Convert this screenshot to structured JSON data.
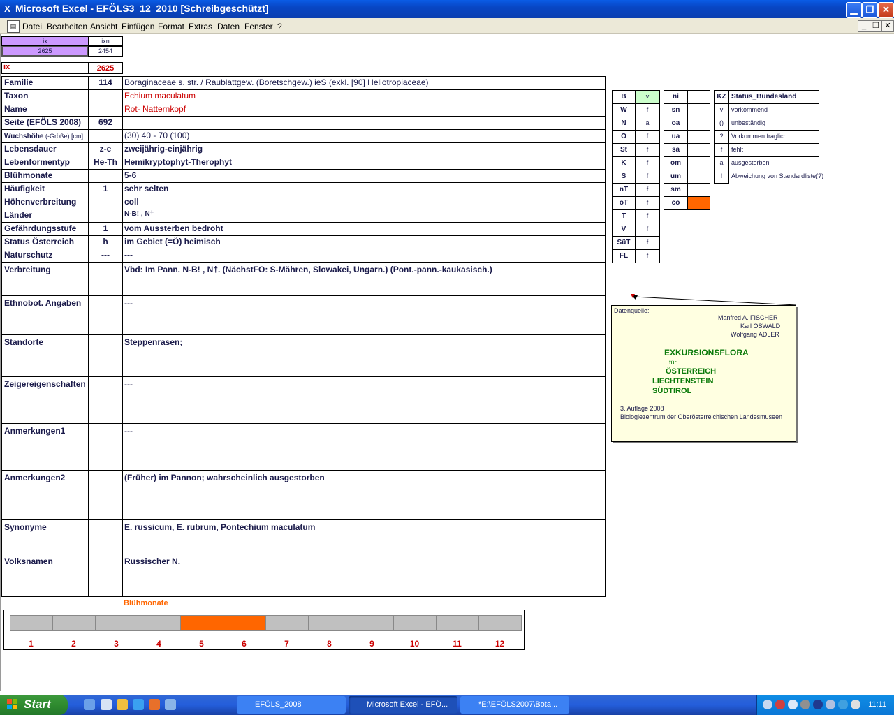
{
  "window": {
    "title": "Microsoft Excel - EFÖLS3_12_2010  [Schreibgeschützt]",
    "min": "▁",
    "restore": "❐",
    "close": "✕"
  },
  "menu": [
    "Datei",
    "Bearbeiten",
    "Ansicht",
    "Einfügen",
    "Format",
    "Extras",
    "Daten",
    "Fenster",
    "?"
  ],
  "header": {
    "ix_label": "ix",
    "ixn_label": "ixn",
    "ix_value": "2625",
    "ixn_value": "2454",
    "ix_big_label": "ix",
    "ix_big_value": "2625"
  },
  "rows": [
    {
      "label": "Familie",
      "code": "114",
      "value": "Boraginaceae s. str.  /  Raublattgew. (Boretschgew.) ieS (exkl. [90] Heliotropiaceae)"
    },
    {
      "label": "Taxon",
      "code": "",
      "value": "Echium maculatum"
    },
    {
      "label": "Name",
      "code": "",
      "value": "Rot- Natternkopf"
    },
    {
      "label": "Seite (EFÖLS 2008)",
      "code": "692",
      "value": ""
    },
    {
      "label": "Wuchshöhe",
      "label_suffix": " (-Größe) [cm]",
      "code": "",
      "value": " (30) 40 - 70 (100)"
    },
    {
      "label": "Lebensdauer",
      "code": "z-e",
      "value": "zweijährig-einjährig"
    },
    {
      "label": "Lebenformentyp",
      "code": "He-Th",
      "value": "Hemikryptophyt-Therophyt"
    },
    {
      "label": "Blühmonate",
      "code": "",
      "value": " 5-6"
    },
    {
      "label": "Häufigkeit",
      "code": "1",
      "value": "sehr selten"
    },
    {
      "label": "Höhenverbreitung",
      "code": "",
      "value": "coll"
    },
    {
      "label": "Länder",
      "code": "",
      "value": "N-B! , N†"
    },
    {
      "label": "Gefährdungsstufe",
      "code": "1",
      "value": "vom Aussterben bedroht"
    },
    {
      "label": "Status Österreich",
      "code": "h",
      "value": "im Gebiet (=Ö) heimisch"
    },
    {
      "label": "Naturschutz",
      "code": "---",
      "value": " ---"
    }
  ],
  "tall_rows": [
    {
      "label": "Verbreitung",
      "value": "Vbd: Im Pann. N-B! , N†. (NächstFO: S-Mähren, Slowakei, Ungarn.) (Pont.-pann.-kaukasisch.)"
    },
    {
      "label": "Ethnobot. Angaben",
      "value": "---"
    },
    {
      "label": "Standorte",
      "value": "Steppenrasen;"
    },
    {
      "label": "Zeigereigenschaften",
      "value": "---"
    },
    {
      "label": "Anmerkungen1",
      "value": "---"
    },
    {
      "label": "Anmerkungen2",
      "value": "(Früher) im Pannon; wahrscheinlich ausgestorben"
    },
    {
      "label": "Synonyme",
      "value": "E. russicum, E. rubrum, Pontechium maculatum"
    },
    {
      "label": "Volksnamen",
      "value": "Russischer N."
    }
  ],
  "state_codes_1": [
    {
      "code": "B",
      "val": "v"
    },
    {
      "code": "W",
      "val": "f"
    },
    {
      "code": "N",
      "val": "a"
    },
    {
      "code": "O",
      "val": "f"
    },
    {
      "code": "St",
      "val": "f"
    },
    {
      "code": "K",
      "val": "f"
    },
    {
      "code": "S",
      "val": "f"
    },
    {
      "code": "nT",
      "val": "f"
    },
    {
      "code": "oT",
      "val": "f"
    },
    {
      "code": "T",
      "val": "f"
    },
    {
      "code": "V",
      "val": "f"
    },
    {
      "code": "SüT",
      "val": "f"
    },
    {
      "code": "FL",
      "val": "f"
    }
  ],
  "state_codes_2": [
    {
      "code": "ni",
      "val": ""
    },
    {
      "code": "sn",
      "val": ""
    },
    {
      "code": "oa",
      "val": ""
    },
    {
      "code": "ua",
      "val": ""
    },
    {
      "code": "sa",
      "val": ""
    },
    {
      "code": "om",
      "val": ""
    },
    {
      "code": "um",
      "val": ""
    },
    {
      "code": "sm",
      "val": ""
    },
    {
      "code": "co",
      "val": ""
    }
  ],
  "legend": {
    "kz_header": "KZ",
    "status_header": "Status_Bundesland",
    "items": [
      {
        "kz": "v",
        "text": "vorkommend"
      },
      {
        "kz": "()",
        "text": "unbeständig"
      },
      {
        "kz": "?",
        "text": "Vorkommen fraglich"
      },
      {
        "kz": "f",
        "text": "fehlt"
      },
      {
        "kz": "a",
        "text": "ausgestorben"
      },
      {
        "kz": "!",
        "text": "Abweichung von Standardliste(?)"
      }
    ]
  },
  "note": {
    "source": "Datenquelle:",
    "author1": "Manfred A. FISCHER",
    "author2": "Karl OSWALD",
    "author3": "Wolfgang ADLER",
    "title": "EXKURSIONSFLORA",
    "fuer": "für",
    "country1": "ÖSTERREICH",
    "country2": "LIECHTENSTEIN",
    "country3": "SÜDTIROL",
    "edition": "3. Auflage 2008",
    "publisher": "Biologiezentrum der Oberösterreichischen Landesmuseen"
  },
  "bloom": {
    "title": "Blühmonate",
    "months": [
      "1",
      "2",
      "3",
      "4",
      "5",
      "6",
      "7",
      "8",
      "9",
      "10",
      "11",
      "12"
    ],
    "active": [
      5,
      6
    ],
    "active_color": "#ff6600",
    "inactive_color": "#c0c0c0"
  },
  "taskbar": {
    "start": "Start",
    "items": [
      "EFÖLS_2008",
      "Microsoft Excel - EFÖ...",
      "*E:\\EFÖLS2007\\Bota..."
    ],
    "clock": "11:11"
  }
}
